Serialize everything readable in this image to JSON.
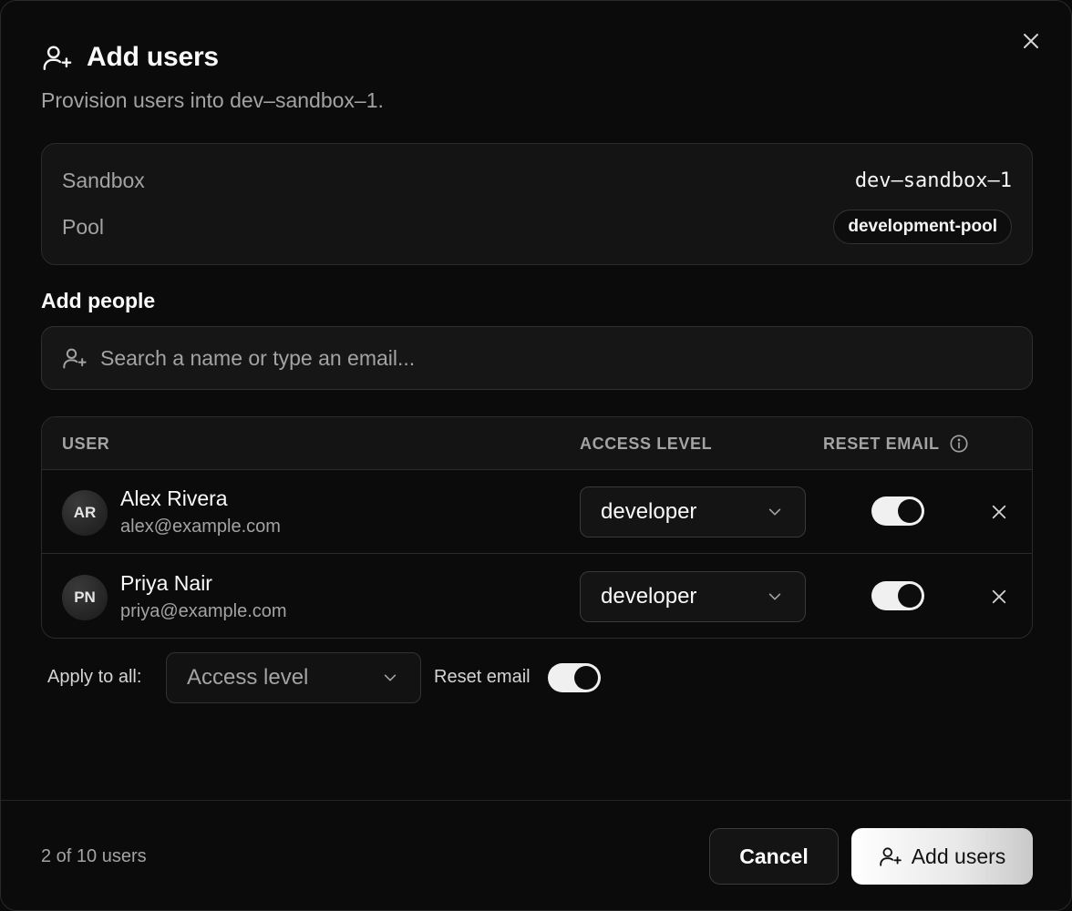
{
  "dialog": {
    "title": "Add users",
    "subtitle": "Provision users into dev–sandbox–1."
  },
  "info": {
    "sandbox_label": "Sandbox",
    "sandbox_value": "dev–sandbox–1",
    "pool_label": "Pool",
    "pool_value": "development-pool"
  },
  "add_people": {
    "label": "Add people",
    "placeholder": "Search a name or type an email..."
  },
  "table": {
    "headers": {
      "user": "USER",
      "access_level": "ACCESS LEVEL",
      "reset_email": "RESET EMAIL"
    },
    "rows": [
      {
        "initials": "AR",
        "name": "Alex Rivera",
        "email": "alex@example.com",
        "access_level": "developer",
        "reset_email": true
      },
      {
        "initials": "PN",
        "name": "Priya Nair",
        "email": "priya@example.com",
        "access_level": "developer",
        "reset_email": true
      }
    ]
  },
  "apply_all": {
    "label": "Apply to all:",
    "access_placeholder": "Access level",
    "reset_label": "Reset email",
    "reset_on": true
  },
  "footer": {
    "count": "2 of 10 users",
    "cancel_label": "Cancel",
    "submit_label": "Add users"
  },
  "icons": {
    "title": "user-plus-icon",
    "search": "user-plus-icon",
    "close": "close-icon",
    "info": "info-icon",
    "chevron": "chevron-down-icon",
    "remove": "close-icon"
  }
}
